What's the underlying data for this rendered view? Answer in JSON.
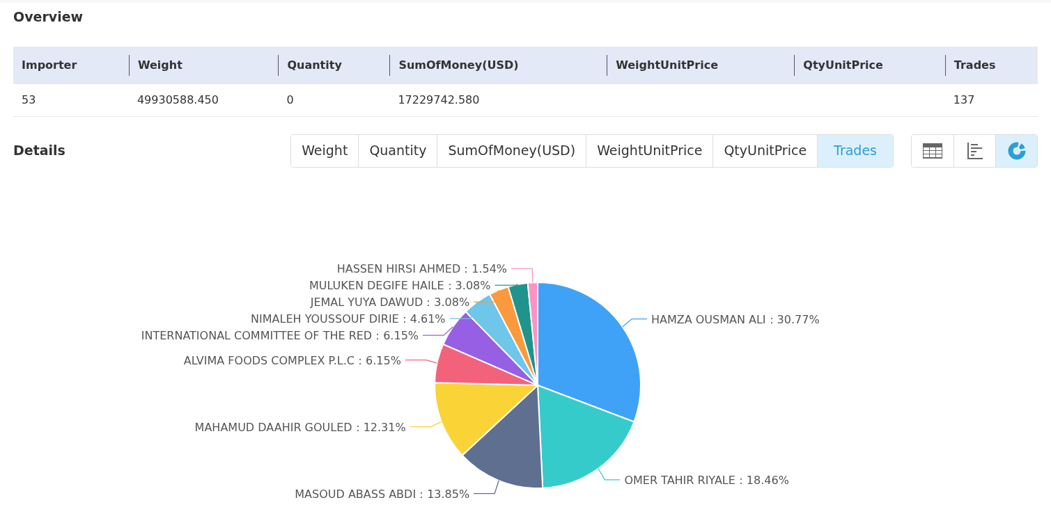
{
  "overview": {
    "title": "Overview",
    "table": {
      "columns": [
        "Importer",
        "Weight",
        "Quantity",
        "SumOfMoney(USD)",
        "WeightUnitPrice",
        "QtyUnitPrice",
        "Trades"
      ],
      "rows": [
        [
          "53",
          "49930588.450",
          "0",
          "17229742.580",
          "",
          "",
          "137"
        ]
      ]
    }
  },
  "details": {
    "title": "Details",
    "tabs": [
      {
        "label": "Weight",
        "selected": false
      },
      {
        "label": "Quantity",
        "selected": false
      },
      {
        "label": "SumOfMoney(USD)",
        "selected": false
      },
      {
        "label": "WeightUnitPrice",
        "selected": false
      },
      {
        "label": "QtyUnitPrice",
        "selected": false
      },
      {
        "label": "Trades",
        "selected": true
      }
    ],
    "views": [
      {
        "kind": "table",
        "selected": false
      },
      {
        "kind": "bar",
        "selected": false
      },
      {
        "kind": "pie",
        "selected": true
      }
    ],
    "chart_data": {
      "type": "pie",
      "categories": [
        "HAMZA OUSMAN ALI",
        "OMER TAHIR RIYALE",
        "MASOUD ABASS ABDI",
        "MAHAMUD DAAHIR GOULED",
        "ALVIMA FOODS COMPLEX P.L.C",
        "INTERNATIONAL COMMITTEE OF THE RED",
        "NIMALEH YOUSSOUF DIRIE",
        "JEMAL YUYA DAWUD",
        "MULUKEN DEGIFE HAILE",
        "HASSEN HIRSI AHMED"
      ],
      "values": [
        30.77,
        18.46,
        13.85,
        12.31,
        6.15,
        6.15,
        4.61,
        3.08,
        3.08,
        1.54
      ],
      "colors": [
        "#3fa2f7",
        "#36cbcb",
        "#5e6f8f",
        "#fad337",
        "#f2637b",
        "#975fe4",
        "#6ec6ea",
        "#fa9a3c",
        "#1f948c",
        "#fc93c4"
      ],
      "value_labels": [
        "：30.77%",
        "：18.46%",
        "：13.85%",
        "：12.31%",
        "：6.15%",
        "：6.15%",
        "：4.61%",
        "：3.08%",
        "：3.08%",
        "：1.54%"
      ]
    }
  }
}
